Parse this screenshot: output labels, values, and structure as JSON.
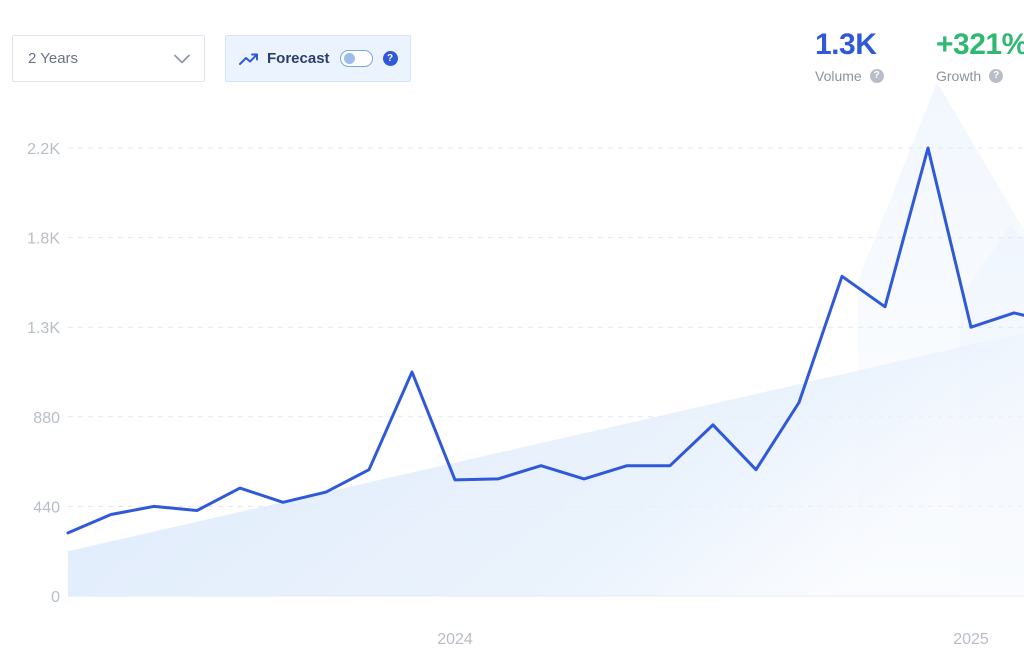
{
  "controls": {
    "range": {
      "value": "2 Years",
      "icon": "chevron-down-icon"
    },
    "forecast": {
      "label": "Forecast",
      "icon": "trending-up-icon",
      "enabled": false,
      "help": "?"
    }
  },
  "stats": {
    "volume": {
      "value": "1.3K",
      "label": "Volume",
      "help": "?"
    },
    "growth": {
      "value": "+321%",
      "label": "Growth",
      "help": "?"
    }
  },
  "colors": {
    "line": "#2f59d9",
    "accent": "#2f59d9",
    "growth": "#2eb872",
    "trend_fill": "#dbe9fb",
    "grid": "#e3e7ee"
  },
  "chart_data": {
    "type": "line",
    "title": "",
    "xlabel": "",
    "ylabel": "",
    "ylim": [
      0,
      2200
    ],
    "y_ticks": [
      {
        "value": 0,
        "label": "0"
      },
      {
        "value": 440,
        "label": "440"
      },
      {
        "value": 880,
        "label": "880"
      },
      {
        "value": 1320,
        "label": "1.3K"
      },
      {
        "value": 1760,
        "label": "1.8K"
      },
      {
        "value": 2200,
        "label": "2.2K"
      }
    ],
    "x_ticks": [
      "2024",
      "2025"
    ],
    "grid": true,
    "series": [
      {
        "values": [
          310,
          400,
          440,
          420,
          530,
          460,
          510,
          620,
          1100,
          570,
          575,
          640,
          575,
          640,
          640,
          840,
          620,
          950,
          1570,
          1420,
          2200,
          1320,
          1390,
          1340
        ]
      }
    ],
    "trend": {
      "values": [
        220,
        1330
      ]
    }
  }
}
